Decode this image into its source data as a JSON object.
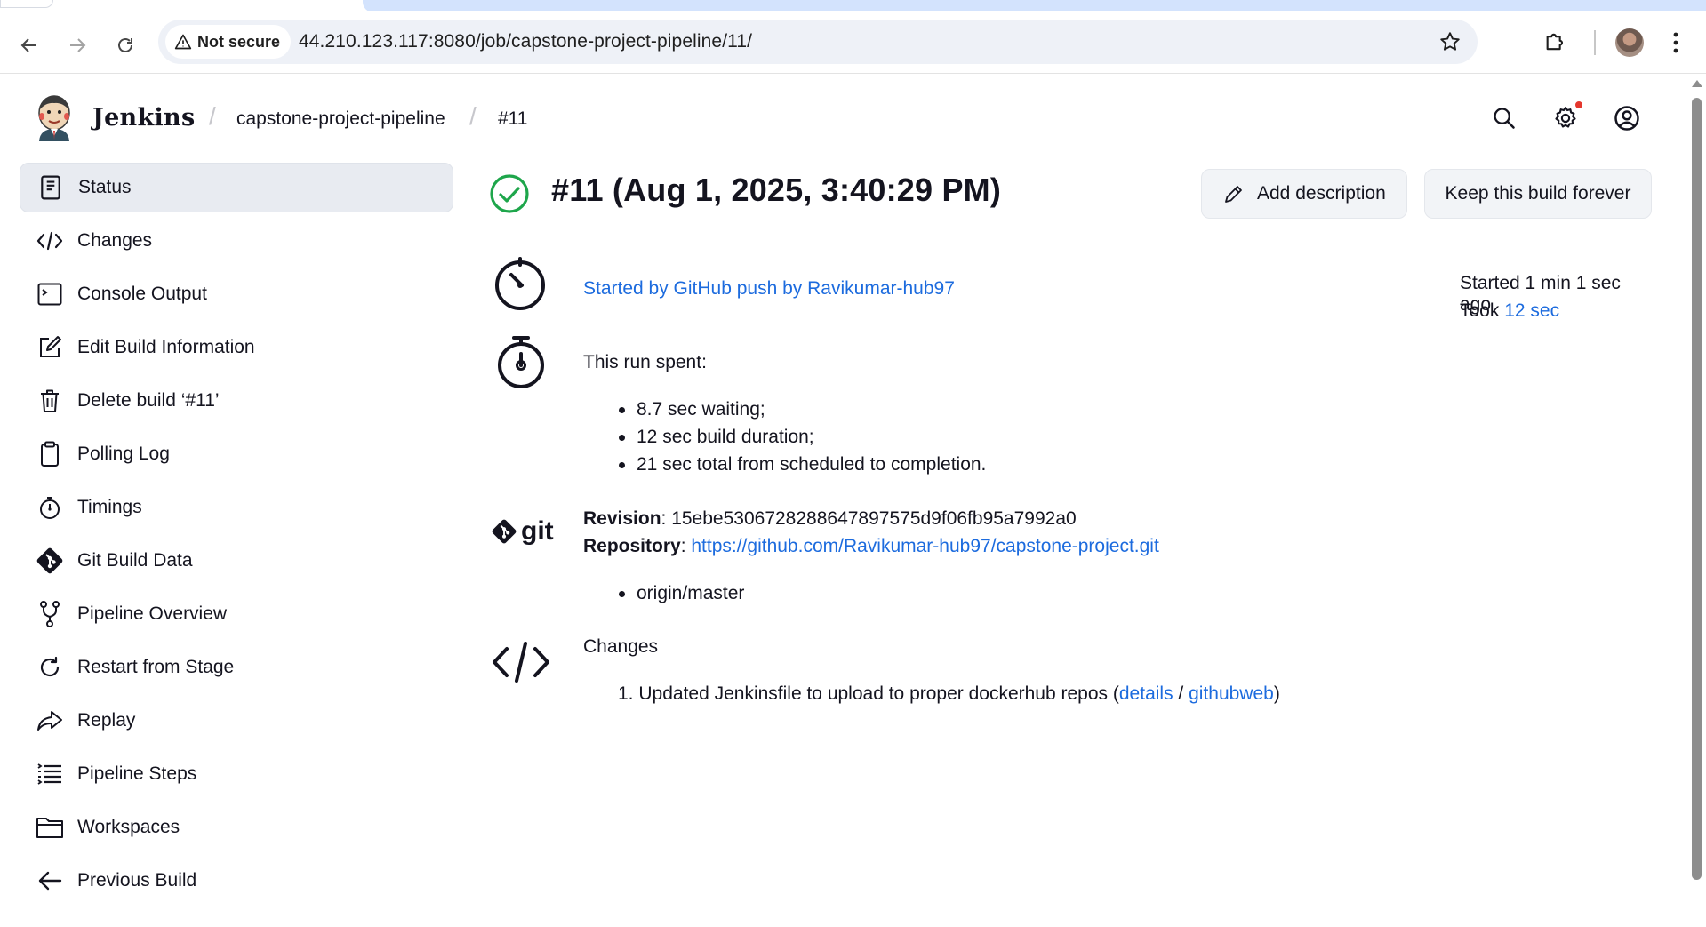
{
  "browser": {
    "security_label": "Not secure",
    "url": "44.210.123.117:8080/job/capstone-project-pipeline/11/"
  },
  "header": {
    "brand": "Jenkins",
    "breadcrumbs": [
      "capstone-project-pipeline",
      "#11"
    ],
    "separator": "/"
  },
  "sidebar": {
    "items": [
      {
        "label": "Status",
        "icon": "document-icon",
        "active": true
      },
      {
        "label": "Changes",
        "icon": "code-icon"
      },
      {
        "label": "Console Output",
        "icon": "terminal-icon"
      },
      {
        "label": "Edit Build Information",
        "icon": "edit-icon"
      },
      {
        "label": "Delete build ‘#11’",
        "icon": "trash-icon"
      },
      {
        "label": "Polling Log",
        "icon": "clipboard-icon"
      },
      {
        "label": "Timings",
        "icon": "stopwatch-icon"
      },
      {
        "label": "Git Build Data",
        "icon": "git-icon"
      },
      {
        "label": "Pipeline Overview",
        "icon": "branch-icon"
      },
      {
        "label": "Restart from Stage",
        "icon": "restart-icon"
      },
      {
        "label": "Replay",
        "icon": "replay-icon"
      },
      {
        "label": "Pipeline Steps",
        "icon": "list-icon"
      },
      {
        "label": "Workspaces",
        "icon": "folder-icon"
      },
      {
        "label": "Previous Build",
        "icon": "arrow-left-icon"
      }
    ]
  },
  "build": {
    "title": "#11 (Aug 1, 2025, 3:40:29 PM)",
    "add_description": "Add description",
    "keep_forever": "Keep this build forever",
    "started_by": "Started by GitHub push by Ravikumar-hub97",
    "started_ago": "Started 1 min 1 sec ago",
    "took_label": "Took",
    "took_value": "12 sec",
    "run_spent_label": "This run spent:",
    "run_spent": [
      "8.7 sec waiting;",
      "12 sec build duration;",
      "21 sec total from scheduled to completion."
    ],
    "revision_label": "Revision",
    "revision_value": "15ebe5306728288647897575d9f06fb95a7992a0",
    "repository_label": "Repository",
    "repository_url": "https://github.com/Ravikumar-hub97/capstone-project.git",
    "branches": [
      "origin/master"
    ],
    "changes_label": "Changes",
    "change_number": "1.",
    "change_text": "Updated Jenkinsfile to upload to proper dockerhub repos",
    "change_details": "details",
    "change_githubweb": "githubweb",
    "git_logo_text": "git"
  },
  "colors": {
    "link": "#1c6bde",
    "success": "#1ea64b",
    "text": "#14141f",
    "active_bg": "#e8ebf1"
  }
}
